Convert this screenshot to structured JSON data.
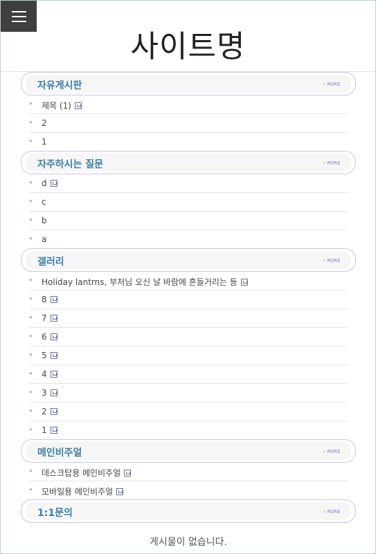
{
  "header": {
    "title": "사이트명"
  },
  "more_label": "MORE",
  "sections": [
    {
      "title": "자유게시판",
      "items": [
        {
          "text": "제목 (1)",
          "new": true
        },
        {
          "text": "2",
          "new": false
        },
        {
          "text": "1",
          "new": false
        }
      ]
    },
    {
      "title": "자주하시는 질문",
      "items": [
        {
          "text": "d",
          "new": true
        },
        {
          "text": "c",
          "new": false
        },
        {
          "text": "b",
          "new": false
        },
        {
          "text": "a",
          "new": false
        }
      ]
    },
    {
      "title": "갤러리",
      "items": [
        {
          "text": "Holiday lantrns, 부처님 오신 날 바람에 흔들거리는 등",
          "new": true
        },
        {
          "text": "8",
          "new": true
        },
        {
          "text": "7",
          "new": true
        },
        {
          "text": "6",
          "new": true
        },
        {
          "text": "5",
          "new": true
        },
        {
          "text": "4",
          "new": true
        },
        {
          "text": "3",
          "new": true
        },
        {
          "text": "2",
          "new": true
        },
        {
          "text": "1",
          "new": true
        }
      ]
    },
    {
      "title": "메인비주얼",
      "items": [
        {
          "text": "데스크탑용 메인비주얼",
          "new": true
        },
        {
          "text": "모바일용 메인비주얼",
          "new": true
        }
      ]
    },
    {
      "title": "1:1문의",
      "items": [],
      "empty_text": "게시물이 없습니다."
    }
  ]
}
